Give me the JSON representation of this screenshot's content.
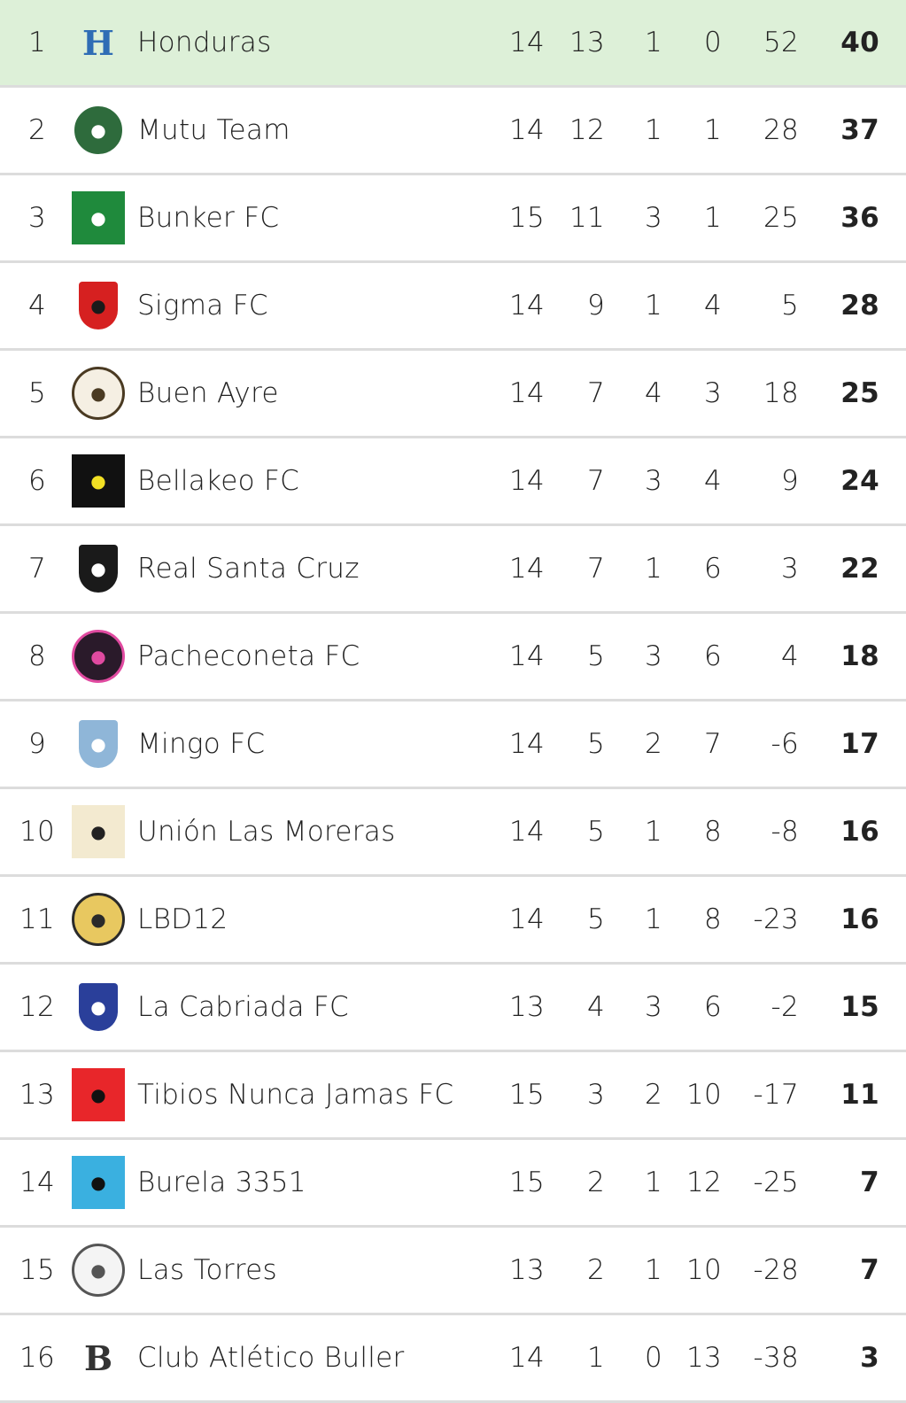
{
  "accent": {
    "leader_bg": "#ddf0d8",
    "divider": "#dcdcdc"
  },
  "standings": [
    {
      "rank": "1",
      "team": "Honduras",
      "pj": "14",
      "g": "13",
      "e": "1",
      "p": "0",
      "dg": "52",
      "pts": "40",
      "logo": {
        "kind": "letter",
        "text": "H",
        "fg": "#2f6db5",
        "bg": "transparent"
      }
    },
    {
      "rank": "2",
      "team": "Mutu Team",
      "pj": "14",
      "g": "12",
      "e": "1",
      "p": "1",
      "dg": "28",
      "pts": "37",
      "logo": {
        "kind": "circle",
        "fg": "#ffffff",
        "bg": "#2e6b3c"
      }
    },
    {
      "rank": "3",
      "team": "Bunker FC",
      "pj": "15",
      "g": "11",
      "e": "3",
      "p": "1",
      "dg": "25",
      "pts": "36",
      "logo": {
        "kind": "square",
        "fg": "#ffffff",
        "bg": "#1f8a3c"
      }
    },
    {
      "rank": "4",
      "team": "Sigma FC",
      "pj": "14",
      "g": "9",
      "e": "1",
      "p": "4",
      "dg": "5",
      "pts": "28",
      "logo": {
        "kind": "shield",
        "fg": "#1a1a1a",
        "bg": "#d62020"
      }
    },
    {
      "rank": "5",
      "team": "Buen Ayre",
      "pj": "14",
      "g": "7",
      "e": "4",
      "p": "3",
      "dg": "18",
      "pts": "25",
      "logo": {
        "kind": "circle",
        "fg": "#4a3a22",
        "bg": "#f5efe3"
      }
    },
    {
      "rank": "6",
      "team": "Bellakeo FC",
      "pj": "14",
      "g": "7",
      "e": "3",
      "p": "4",
      "dg": "9",
      "pts": "24",
      "logo": {
        "kind": "square",
        "fg": "#f2e024",
        "bg": "#111111"
      }
    },
    {
      "rank": "7",
      "team": "Real Santa Cruz",
      "pj": "14",
      "g": "7",
      "e": "1",
      "p": "6",
      "dg": "3",
      "pts": "22",
      "logo": {
        "kind": "shield",
        "fg": "#ffffff",
        "bg": "#1a1a1a"
      }
    },
    {
      "rank": "8",
      "team": "Pacheconeta FC",
      "pj": "14",
      "g": "5",
      "e": "3",
      "p": "6",
      "dg": "4",
      "pts": "18",
      "logo": {
        "kind": "circle",
        "fg": "#e04aa0",
        "bg": "#2a1a2a"
      }
    },
    {
      "rank": "9",
      "team": "Mingo FC",
      "pj": "14",
      "g": "5",
      "e": "2",
      "p": "7",
      "dg": "-6",
      "pts": "17",
      "logo": {
        "kind": "shield",
        "fg": "#ffffff",
        "bg": "#8fb6d8"
      }
    },
    {
      "rank": "10",
      "team": "Unión Las Moreras",
      "pj": "14",
      "g": "5",
      "e": "1",
      "p": "8",
      "dg": "-8",
      "pts": "16",
      "logo": {
        "kind": "square",
        "fg": "#222222",
        "bg": "#f3ead0"
      }
    },
    {
      "rank": "11",
      "team": "LBD12",
      "pj": "14",
      "g": "5",
      "e": "1",
      "p": "8",
      "dg": "-23",
      "pts": "16",
      "logo": {
        "kind": "circle",
        "fg": "#2a2a2a",
        "bg": "#e8c860"
      }
    },
    {
      "rank": "12",
      "team": "La Cabriada FC",
      "pj": "13",
      "g": "4",
      "e": "3",
      "p": "6",
      "dg": "-2",
      "pts": "15",
      "logo": {
        "kind": "shield",
        "fg": "#ffffff",
        "bg": "#2a3f9a"
      }
    },
    {
      "rank": "13",
      "team": "Tibios Nunca Jamas FC",
      "pj": "15",
      "g": "3",
      "e": "2",
      "p": "10",
      "dg": "-17",
      "pts": "11",
      "logo": {
        "kind": "square",
        "fg": "#111111",
        "bg": "#e8262a"
      }
    },
    {
      "rank": "14",
      "team": "Burela 3351",
      "pj": "15",
      "g": "2",
      "e": "1",
      "p": "12",
      "dg": "-25",
      "pts": "7",
      "logo": {
        "kind": "square",
        "fg": "#111111",
        "bg": "#3ab0e0"
      }
    },
    {
      "rank": "15",
      "team": "Las Torres",
      "pj": "13",
      "g": "2",
      "e": "1",
      "p": "10",
      "dg": "-28",
      "pts": "7",
      "logo": {
        "kind": "circle",
        "fg": "#555555",
        "bg": "#f4f4f4"
      }
    },
    {
      "rank": "16",
      "team": "Club Atlético Buller",
      "pj": "14",
      "g": "1",
      "e": "0",
      "p": "13",
      "dg": "-38",
      "pts": "3",
      "logo": {
        "kind": "letter",
        "text": "B",
        "fg": "#333333",
        "bg": "transparent"
      }
    }
  ]
}
